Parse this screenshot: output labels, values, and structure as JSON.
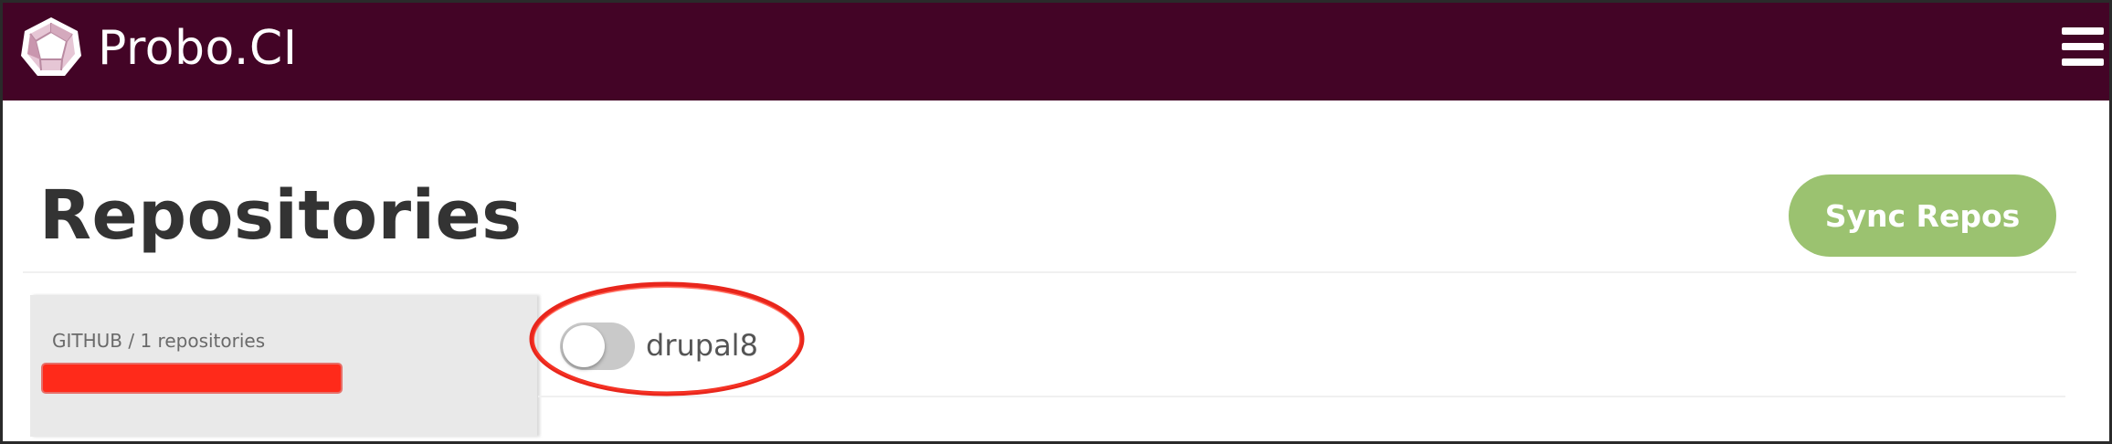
{
  "app": {
    "brand": "Probo.CI",
    "logo_icon": "probo-dodecahedron-logo",
    "menu_icon": "hamburger-menu-icon"
  },
  "colors": {
    "topbar": "#430426",
    "sync_button": "#9bc270",
    "page_title": "#333333",
    "source_panel": "#e9e9e9",
    "toggle_off": "#c9c9c9",
    "annotation_ring": "#e8261c",
    "redaction": "#ff2a1a"
  },
  "page": {
    "title": "Repositories",
    "sync_button_label": "Sync Repos"
  },
  "source_panel": {
    "caption": "GITHUB / 1 repositories",
    "account_redacted": true
  },
  "repositories": [
    {
      "name": "drupal8",
      "enabled": false,
      "highlighted": true
    }
  ]
}
